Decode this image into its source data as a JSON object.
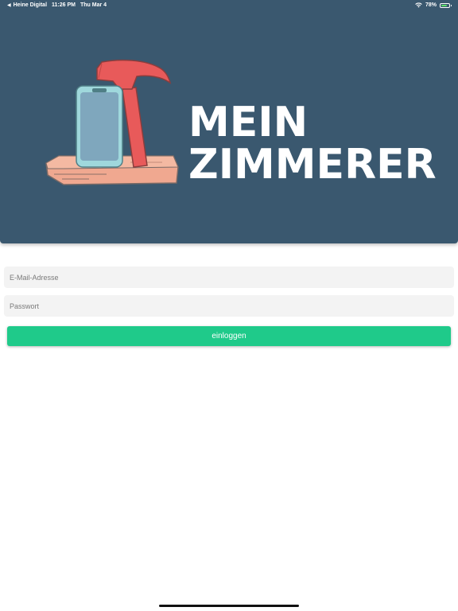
{
  "status_bar": {
    "back_app": "Heine Digital",
    "time": "11:26 PM",
    "date": "Thu Mar 4",
    "battery": "78%",
    "battery_level": 0.78
  },
  "brand": {
    "line1": "MEIN",
    "line2": "ZIMMERER"
  },
  "login_form": {
    "email_placeholder": "E-Mail-Adresse",
    "password_placeholder": "Passwort",
    "submit_label": "einloggen"
  },
  "colors": {
    "banner": "#3a586f",
    "button": "#1fca8a",
    "hammer": "#e85a5a",
    "wood": "#f0a890",
    "phone": "#9fd8dc"
  }
}
